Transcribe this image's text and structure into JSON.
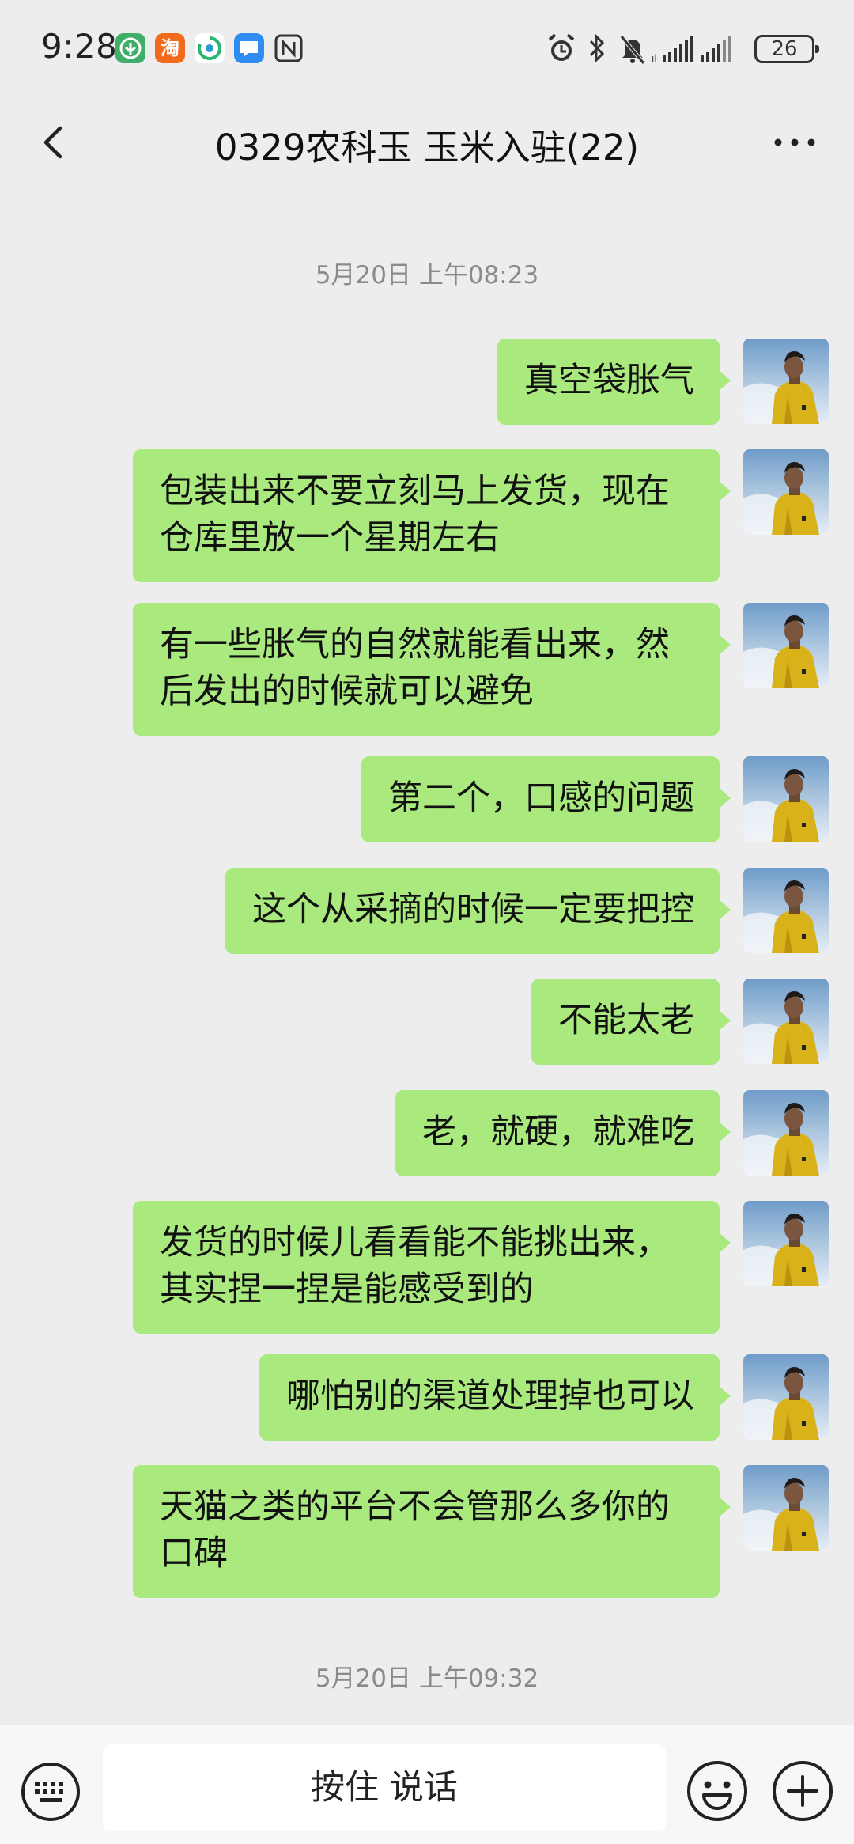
{
  "status_bar": {
    "time": "9:28",
    "battery": "26",
    "app_icons": [
      "tree-app-icon",
      "taobao-icon",
      "swirl-app-icon",
      "message-app-icon",
      "nfc-icon"
    ],
    "taobao_label": "淘",
    "right_icons": [
      "alarm-icon",
      "bluetooth-icon",
      "mute-bell-icon",
      "signal-icon",
      "signal-icon"
    ]
  },
  "header": {
    "title": "0329农科玉 玉米入驻(22)"
  },
  "timestamps": [
    "5月20日 上午08:23",
    "5月20日 上午09:32"
  ],
  "messages": [
    {
      "text": "真空袋胀气"
    },
    {
      "text": "包装出来不要立刻马上发货，现在仓库里放一个星期左右"
    },
    {
      "text": "有一些胀气的自然就能看出来，然后发出的时候就可以避免"
    },
    {
      "text": "第二个，口感的问题"
    },
    {
      "text": "这个从采摘的时候一定要把控"
    },
    {
      "text": "不能太老"
    },
    {
      "text": "老，就硬，就难吃"
    },
    {
      "text": "发货的时候儿看看能不能挑出来，其实捏一捏是能感受到的"
    },
    {
      "text": "哪怕别的渠道处理掉也可以"
    },
    {
      "text": "天猫之类的平台不会管那么多你的口碑"
    }
  ],
  "input_bar": {
    "voice_label": "按住 说话"
  },
  "colors": {
    "bubble": "#a9e97e",
    "background": "#ededed",
    "input_bar": "#f7f7f7"
  }
}
